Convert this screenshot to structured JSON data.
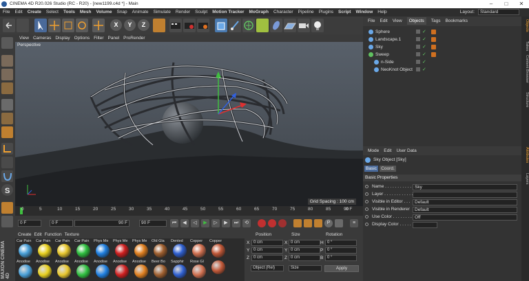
{
  "title": "CINEMA 4D R20.026 Studio (RC - R20) - [new1199.c4d *] - Main",
  "menu": [
    "File",
    "Edit",
    "Create",
    "Select",
    "Tools",
    "Mesh",
    "Volume",
    "Snap",
    "Animate",
    "Simulate",
    "Render",
    "Sculpt",
    "Motion Tracker",
    "MoGraph",
    "Character",
    "Pipeline",
    "Plugins",
    "Script",
    "Window",
    "Help"
  ],
  "layout": {
    "label": "Layout:",
    "value": "Standard"
  },
  "viewport_menu": [
    "View",
    "Cameras",
    "Display",
    "Options",
    "Filter",
    "Panel",
    "ProRender"
  ],
  "viewport": {
    "name": "Perspective",
    "grid": "Grid Spacing : 100 cm"
  },
  "timeline": {
    "ticks": [
      "0",
      "5",
      "10",
      "15",
      "20",
      "25",
      "30",
      "35",
      "40",
      "45",
      "50",
      "55",
      "60",
      "65",
      "70",
      "75",
      "80",
      "85",
      "90"
    ],
    "end": "0 F"
  },
  "anim": {
    "start": "0 F",
    "cur": "0 F",
    "end_a": "90 F",
    "end_b": "90 F"
  },
  "mat_menu": [
    "Create",
    "Edit",
    "Function",
    "Texture"
  ],
  "materials": [
    {
      "top": "Car Pain",
      "bot": "Anodise",
      "color": "#4aa0d8"
    },
    {
      "top": "Car Pain",
      "bot": "Anodise",
      "color": "#e8d020"
    },
    {
      "top": "Car Pain",
      "bot": "Anodise",
      "color": "#e8c830"
    },
    {
      "top": "Car Pain",
      "bot": "Anodise",
      "color": "#30c040"
    },
    {
      "top": "Phys Me",
      "bot": "Anodise",
      "color": "#2080e0"
    },
    {
      "top": "Phys Me",
      "bot": "Anodise",
      "color": "#d02020"
    },
    {
      "top": "Phys Me",
      "bot": "Anodise",
      "color": "#e08020"
    },
    {
      "top": "Old Gla",
      "bot": "Beer Bo",
      "color": "#a06030"
    },
    {
      "top": "Dented",
      "bot": "Sapphir",
      "color": "#3060d0"
    },
    {
      "top": "Copper",
      "bot": "Rose Gl",
      "color": "#d07050"
    },
    {
      "top": "Copper",
      "bot": "",
      "color": "#c05838"
    }
  ],
  "coords": {
    "headers": [
      "Position",
      "Size",
      "Rotation"
    ],
    "rows": [
      {
        "a": "X",
        "p": "0 cm",
        "b": "X",
        "s": "0 cm",
        "c": "H",
        "r": "0 °"
      },
      {
        "a": "Y",
        "p": "0 cm",
        "b": "Y",
        "s": "0 cm",
        "c": "P",
        "r": "0 °"
      },
      {
        "a": "Z",
        "p": "0 cm",
        "b": "Z",
        "s": "0 cm",
        "c": "B",
        "r": "0 °"
      }
    ],
    "mode": "Object (Rel)",
    "size_mode": "Size",
    "apply": "Apply"
  },
  "obj_menu": [
    "File",
    "Edit",
    "View",
    "Objects",
    "Tags",
    "Bookmarks"
  ],
  "objects": [
    {
      "name": "Sphere",
      "color": "#6aa8e8",
      "indent": 0,
      "tag": true
    },
    {
      "name": "Landscape.1",
      "color": "#6aa8e8",
      "indent": 0,
      "tag": true
    },
    {
      "name": "Sky",
      "color": "#6aa8e8",
      "indent": 0,
      "tag": true
    },
    {
      "name": "Sweep",
      "color": "#60c060",
      "indent": 0,
      "tag": true
    },
    {
      "name": "n-Side",
      "color": "#6aa8e8",
      "indent": 1,
      "tag": false
    },
    {
      "name": "NeoKnot Object",
      "color": "#6aa8e8",
      "indent": 1,
      "tag": false
    }
  ],
  "attr_menu": [
    "Mode",
    "Edit",
    "User Data"
  ],
  "attr": {
    "object": "Sky Object [Sky]",
    "tabs": [
      "Basic",
      "Coord."
    ],
    "section": "Basic Properties",
    "rows": [
      {
        "label": "Name . . . . . . . . . . . . .",
        "value": "Sky"
      },
      {
        "label": "Layer . . . . . . . . . . . . .",
        "value": ""
      },
      {
        "label": "Visible in Editor . . .",
        "value": "Default"
      },
      {
        "label": "Visible in Renderer",
        "value": "Default"
      },
      {
        "label": "Use Color . . . . . . . . .",
        "value": "Off"
      },
      {
        "label": "Display Color . . . . . .",
        "value": ""
      }
    ]
  },
  "right_tabs": [
    "Objects",
    "Takes",
    "Content Browser",
    "Structure",
    "Attributes",
    "Layers"
  ],
  "brand": "MAXON CINEMA 4D"
}
